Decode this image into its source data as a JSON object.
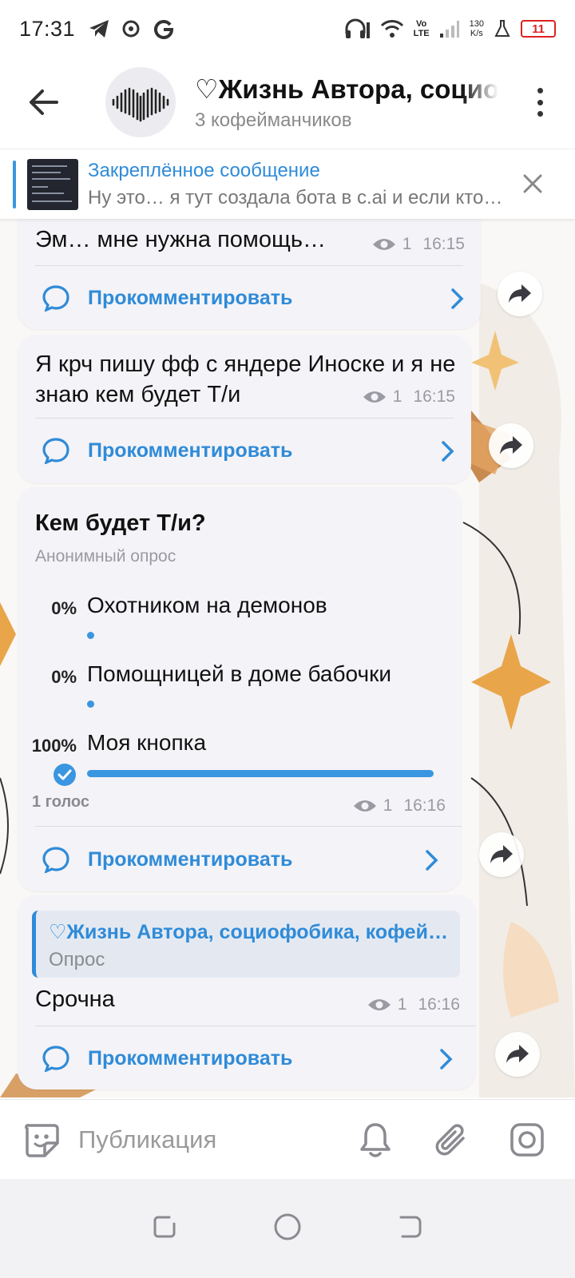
{
  "status_bar": {
    "time": "17:31",
    "net_speed_value": "130",
    "net_speed_unit": "K/s",
    "volte_top": "Vo",
    "volte_bottom": "LTE",
    "battery": "11"
  },
  "header": {
    "title": "♡Жизнь Автора, социофобика, кофейманчик",
    "subtitle": "3 кофейманчиков"
  },
  "pinned": {
    "title": "Закреплённое сообщение",
    "body": "Ну это… я тут создала бота в c.ai и если кто хочет"
  },
  "messages": {
    "m1": {
      "text": "Эм… мне нужна помощь…",
      "views": "1",
      "time": "16:15",
      "comment": "Прокомментировать"
    },
    "m2": {
      "text": "Я крч пишу фф с яндере Иноске и я не знаю кем будет Т/и",
      "views": "1",
      "time": "16:15",
      "comment": "Прокомментировать"
    },
    "poll": {
      "question": "Кем будет Т/и?",
      "type": "Анонимный опрос",
      "options": [
        {
          "pct": "0%",
          "label": "Охотником на демонов",
          "share": 0
        },
        {
          "pct": "0%",
          "label": "Помощницей в доме бабочки",
          "share": 0
        },
        {
          "pct": "100%",
          "label": "Моя кнопка",
          "share": 1
        }
      ],
      "votes": "1 голос",
      "views": "1",
      "time": "16:16",
      "comment": "Прокомментировать"
    },
    "m4": {
      "quote_title": "♡Жизнь Автора, социофобика, кофейманчик",
      "quote_sub": "Опрос",
      "text": "Срочна",
      "views": "1",
      "time": "16:16",
      "comment": "Прокомментировать"
    }
  },
  "input": {
    "placeholder": "Публикация"
  },
  "colors": {
    "accent": "#2f8bd8",
    "bubble": "#f4f3f7",
    "battery": "#dd2222"
  }
}
